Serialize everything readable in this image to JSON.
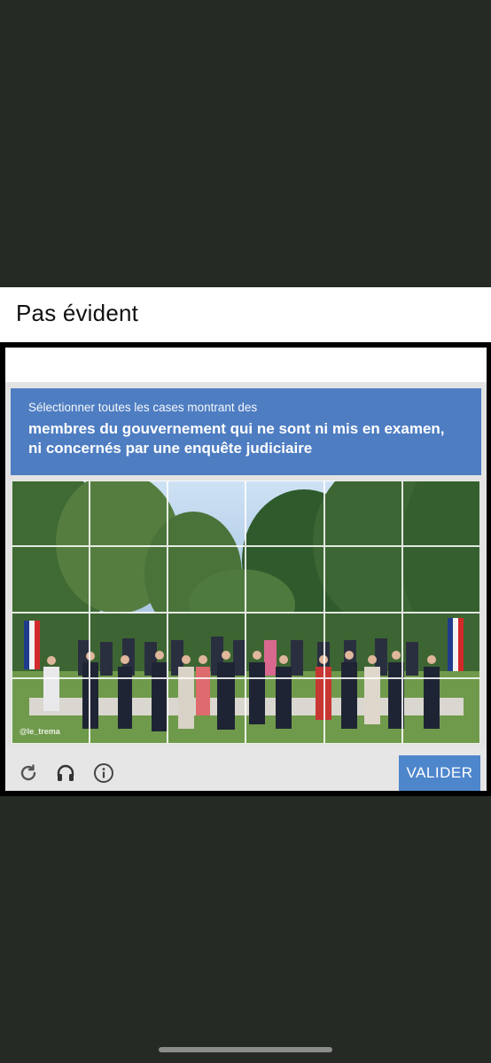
{
  "post": {
    "caption": "Pas évident"
  },
  "captcha": {
    "instruction_line1": "Sélectionner toutes les cases montrant des",
    "instruction_line2": "membres du gouvernement qui ne sont ni mis en examen,",
    "instruction_line3": "ni concernés par une enquête judiciaire",
    "watermark": "@le_trema",
    "grid": {
      "rows": 4,
      "columns": 6
    },
    "verify_label": "VALIDER",
    "banner_color": "#4e7dc2",
    "button_color": "#4e86cc",
    "tools": [
      "reload-icon",
      "headphones-icon",
      "info-icon"
    ]
  }
}
